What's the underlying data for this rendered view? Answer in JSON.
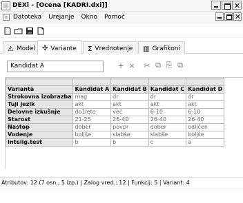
{
  "window": {
    "title": "DEXi - [Ocena [KADRI.dxi]]"
  },
  "menu": {
    "items": [
      "Datoteka",
      "Urejanje",
      "Okno",
      "Pomoč"
    ]
  },
  "toolbar": {
    "icons": [
      "new-document-icon",
      "open-folder-icon",
      "save-icon",
      "print-icon"
    ]
  },
  "tabs": [
    {
      "label": "Model",
      "icon": "triangle-model-icon",
      "active": false
    },
    {
      "label": "Variante",
      "icon": "variants-icon",
      "active": true
    },
    {
      "label": "Vrednotenje",
      "icon": "sigma-icon",
      "active": false
    },
    {
      "label": "Grafikoni",
      "icon": "chart-icon",
      "active": false
    }
  ],
  "editor": {
    "current_value": "Kandidat A",
    "buttons": [
      "add-variant-icon",
      "delete-variant-icon",
      "cut-icon",
      "copy-icon",
      "paste-icon",
      "duplicate-icon"
    ]
  },
  "table": {
    "header": {
      "first": "Varianta",
      "variants": [
        "Kandidat A",
        "Kandidat B",
        "Kandidat C",
        "Kandidat D"
      ]
    },
    "rows": [
      {
        "name": "Strokovna izobrazba",
        "values": [
          "mag",
          "dr",
          "dr",
          "dr"
        ]
      },
      {
        "name": "Tuji jezik",
        "values": [
          "akt",
          "akt",
          "akt",
          "akt"
        ]
      },
      {
        "name": "Delovne izkušnje",
        "values": [
          "do1leto",
          "več",
          "6-10",
          "6-10"
        ]
      },
      {
        "name": "Starost",
        "values": [
          "21-25",
          "26-40",
          "26-40",
          "26-40"
        ]
      },
      {
        "name": "Nastop",
        "values": [
          "dober",
          "povpr",
          "dober",
          "odličen"
        ]
      },
      {
        "name": "Vodenje",
        "values": [
          "boljše",
          "slabše",
          "slabše",
          "boljše"
        ]
      },
      {
        "name": "Intelig.test",
        "values": [
          "b",
          "b",
          "c",
          "a"
        ]
      }
    ]
  },
  "status": {
    "text": "Atributov: 12 (7 osn., 5 izp.) | Zalog vred.: 12 | Funkcij: 5 | Variant: 4"
  }
}
